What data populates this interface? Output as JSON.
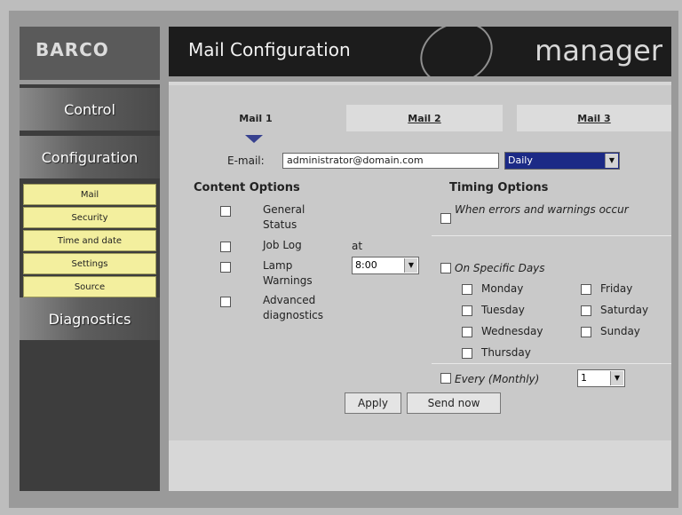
{
  "brand": {
    "logo_text": "BARCO",
    "product": "manager",
    "product_prefix": "e"
  },
  "header": {
    "title": "Mail Configuration"
  },
  "sidebar": {
    "categories": [
      {
        "label": "Control"
      },
      {
        "label": "Configuration"
      },
      {
        "label": "Diagnostics"
      }
    ],
    "items": [
      {
        "label": "Mail"
      },
      {
        "label": "Security"
      },
      {
        "label": "Time and date"
      },
      {
        "label": "Settings"
      },
      {
        "label": "Source"
      }
    ]
  },
  "tabs": [
    {
      "label": "Mail 1",
      "active": true
    },
    {
      "label": "Mail 2",
      "active": false
    },
    {
      "label": "Mail 3",
      "active": false
    }
  ],
  "email": {
    "label": "E-mail:",
    "value": "administrator@domain.com"
  },
  "frequency": {
    "selected": "Daily"
  },
  "content_options": {
    "heading": "Content Options",
    "items": [
      {
        "label": "General Status",
        "checked": false
      },
      {
        "label": "Job Log",
        "checked": false
      },
      {
        "label": "Lamp Warnings",
        "checked": false
      },
      {
        "label": "Advanced diagnostics",
        "checked": false
      }
    ]
  },
  "time": {
    "at_label": "at",
    "selected": "8:00"
  },
  "timing_options": {
    "heading": "Timing Options",
    "on_errors": {
      "label": "When errors and warnings occur",
      "checked": false
    },
    "on_specific_days": {
      "label": "On Specific Days",
      "checked": false
    },
    "days": [
      {
        "label": "Monday",
        "checked": false
      },
      {
        "label": "Tuesday",
        "checked": false
      },
      {
        "label": "Wednesday",
        "checked": false
      },
      {
        "label": "Thursday",
        "checked": false
      },
      {
        "label": "Friday",
        "checked": false
      },
      {
        "label": "Saturday",
        "checked": false
      },
      {
        "label": "Sunday",
        "checked": false
      }
    ],
    "monthly": {
      "label": "Every (Monthly)",
      "checked": false,
      "selected": "1"
    }
  },
  "buttons": {
    "apply": "Apply",
    "send_now": "Send now"
  }
}
